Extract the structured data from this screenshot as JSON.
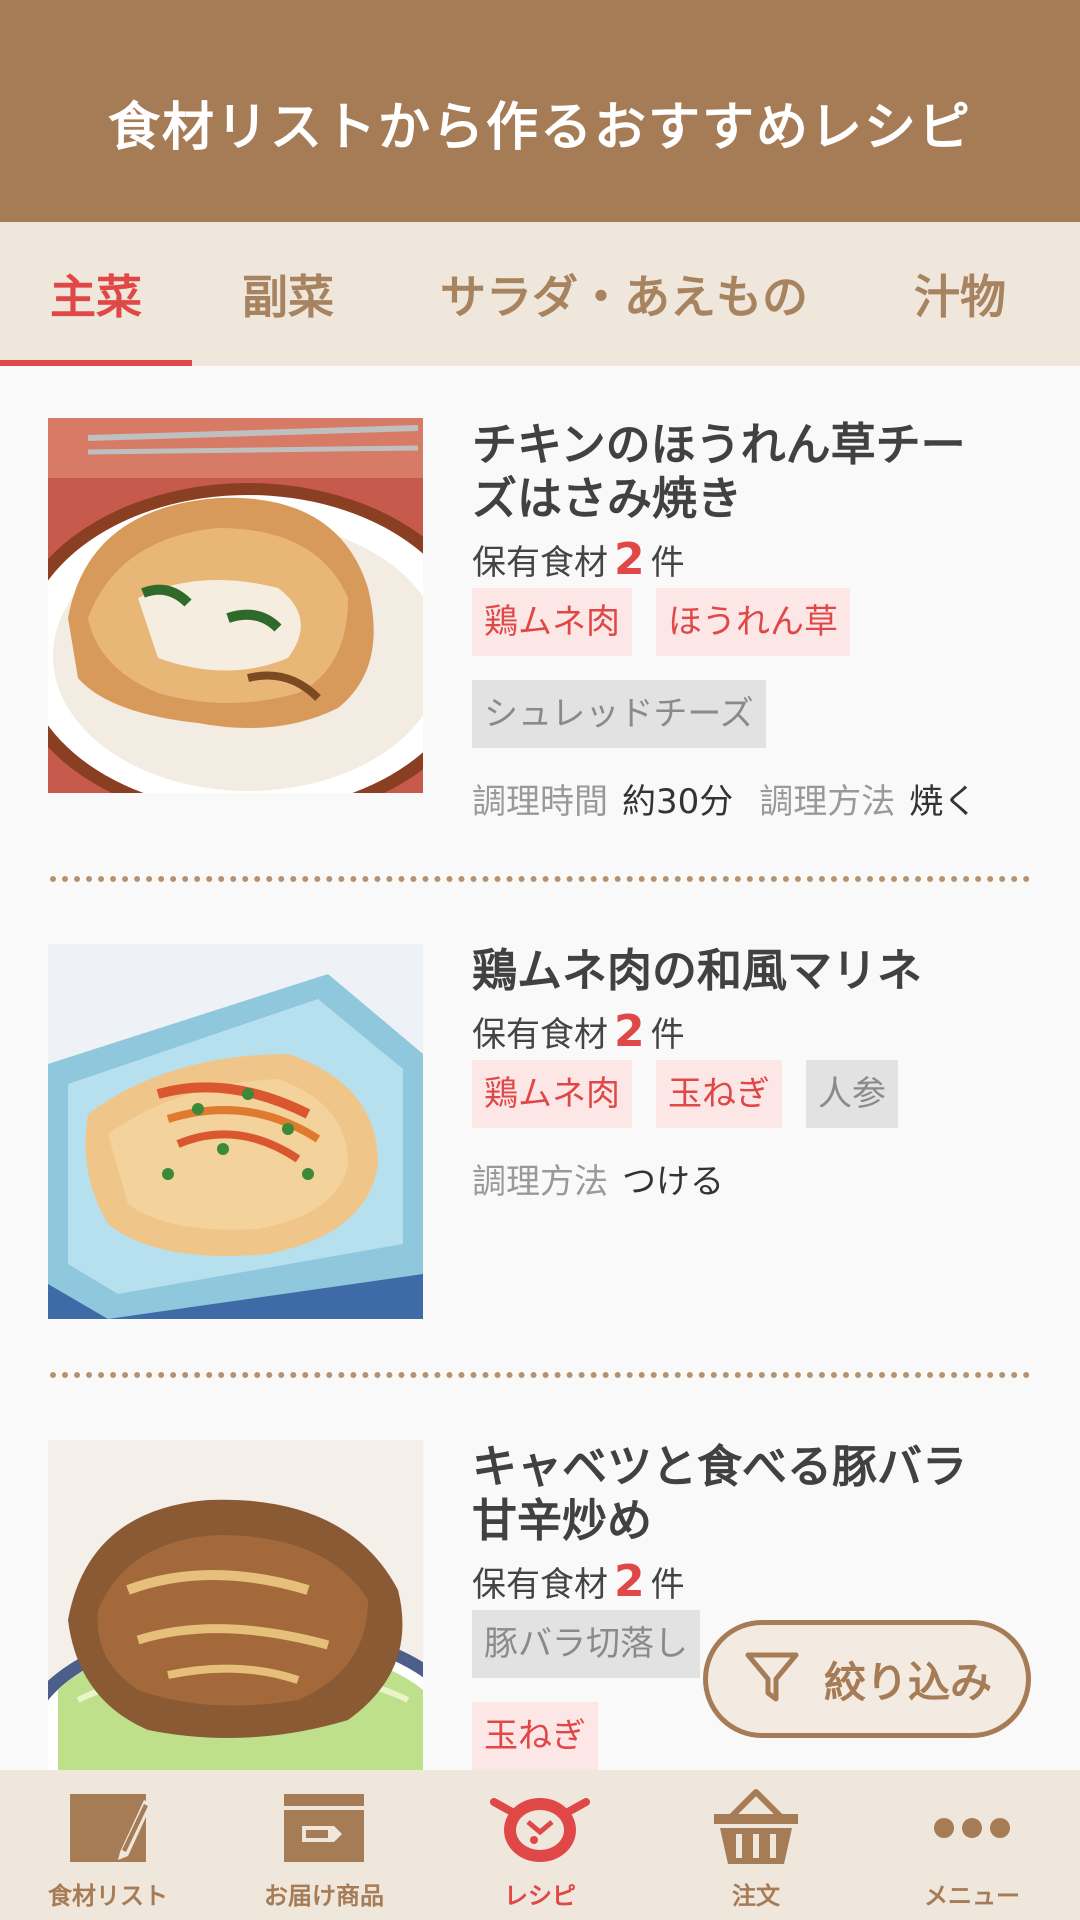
{
  "header": {
    "title": "食材リストから作るおすすめレシピ"
  },
  "tabs": [
    {
      "label": "主菜"
    },
    {
      "label": "副菜"
    },
    {
      "label": "サラダ・あえもの"
    },
    {
      "label": "汁物"
    }
  ],
  "recipes": [
    {
      "title_line1": "チキンのほうれん草チー",
      "title_line2": "ズはさみ焼き",
      "owned_prefix": "保有食材",
      "owned_count": "2",
      "owned_suffix": "件",
      "owned_tags": [
        "鶏ムネ肉",
        "ほうれん草"
      ],
      "missing_tags": [
        "シュレッドチーズ"
      ],
      "time_label": "調理時間",
      "time_value": "約30分",
      "method_label": "調理方法",
      "method_value": "焼く"
    },
    {
      "title_line1": "鶏ムネ肉の和風マリネ",
      "owned_prefix": "保有食材",
      "owned_count": "2",
      "owned_suffix": "件",
      "owned_tags": [
        "鶏ムネ肉",
        "玉ねぎ"
      ],
      "missing_tags": [
        "人参"
      ],
      "method_label": "調理方法",
      "method_value": "つける"
    },
    {
      "title_line1": "キャベツと食べる豚バラ",
      "title_line2": "甘辛炒め",
      "owned_prefix": "保有食材",
      "owned_count": "2",
      "owned_suffix": "件",
      "missing_tags": [
        "豚バラ切落し"
      ],
      "owned_tags": [
        "玉ねぎ"
      ]
    }
  ],
  "filter": {
    "label": "絞り込み",
    "icon": "filter-icon"
  },
  "bottom_nav": [
    {
      "label": "食材リスト",
      "icon": "pencil-note-icon"
    },
    {
      "label": "お届け商品",
      "icon": "delivery-box-icon"
    },
    {
      "label": "レシピ",
      "icon": "recipe-pot-icon"
    },
    {
      "label": "注文",
      "icon": "basket-icon"
    },
    {
      "label": "メニュー",
      "icon": "more-dots-icon"
    }
  ],
  "colors": {
    "header_bg": "#a67c56",
    "tab_bg": "#efe6dc",
    "accent_red": "#e04848",
    "brown": "#a67c56",
    "owned_tag_bg": "#fde6e6",
    "missing_tag_bg": "#e2e2e2"
  }
}
